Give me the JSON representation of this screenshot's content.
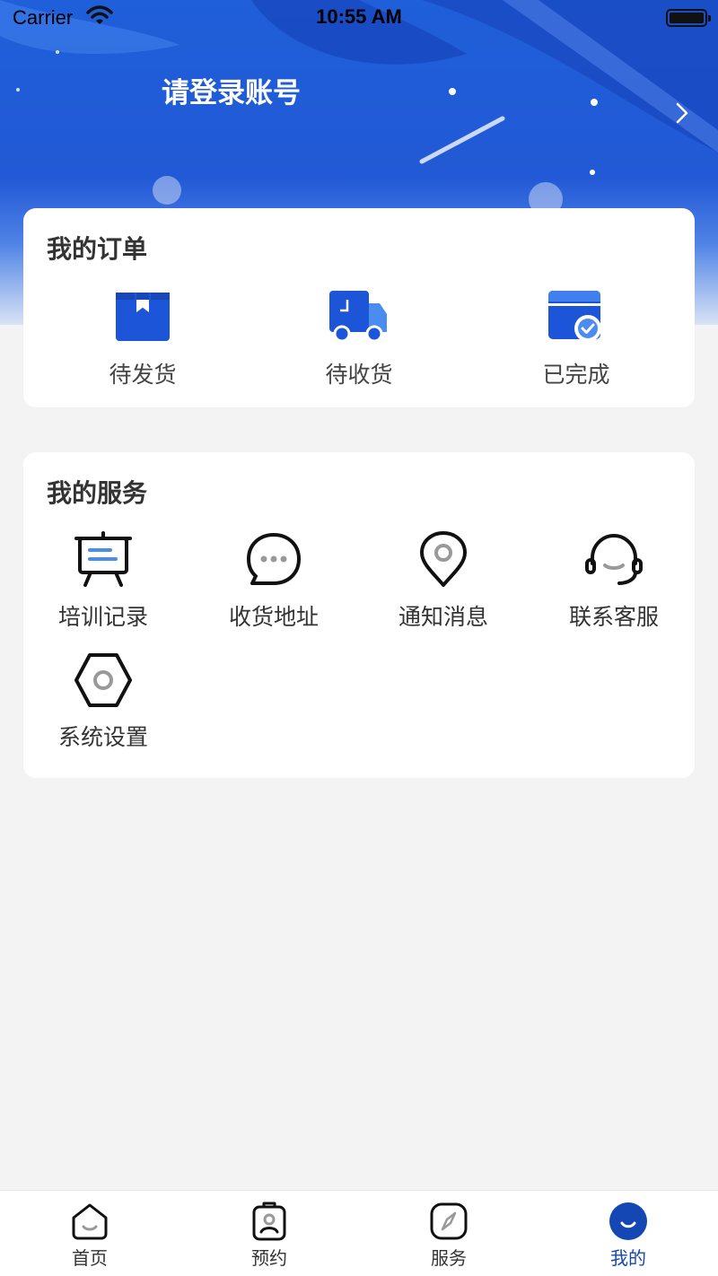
{
  "status_bar": {
    "carrier": "Carrier",
    "time": "10:55 AM"
  },
  "header": {
    "login_prompt": "请登录账号",
    "background_color": "#1f5fd9"
  },
  "orders": {
    "title": "我的订单",
    "items": [
      {
        "label": "待发货",
        "icon": "package-icon"
      },
      {
        "label": "待收货",
        "icon": "delivery-truck-icon"
      },
      {
        "label": "已完成",
        "icon": "completed-box-icon"
      }
    ]
  },
  "services": {
    "title": "我的服务",
    "items": [
      {
        "label": "培训记录",
        "icon": "presentation-board-icon"
      },
      {
        "label": "收货地址",
        "icon": "chat-bubble-icon"
      },
      {
        "label": "通知消息",
        "icon": "location-pin-icon"
      },
      {
        "label": "联系客服",
        "icon": "headset-icon"
      },
      {
        "label": "系统设置",
        "icon": "hexagon-settings-icon"
      }
    ]
  },
  "tabbar": {
    "items": [
      {
        "label": "首页",
        "icon": "home-icon",
        "active": false
      },
      {
        "label": "预约",
        "icon": "appointment-icon",
        "active": false
      },
      {
        "label": "服务",
        "icon": "compass-icon",
        "active": false
      },
      {
        "label": "我的",
        "icon": "profile-icon",
        "active": true
      }
    ],
    "active_color": "#1447b4"
  }
}
